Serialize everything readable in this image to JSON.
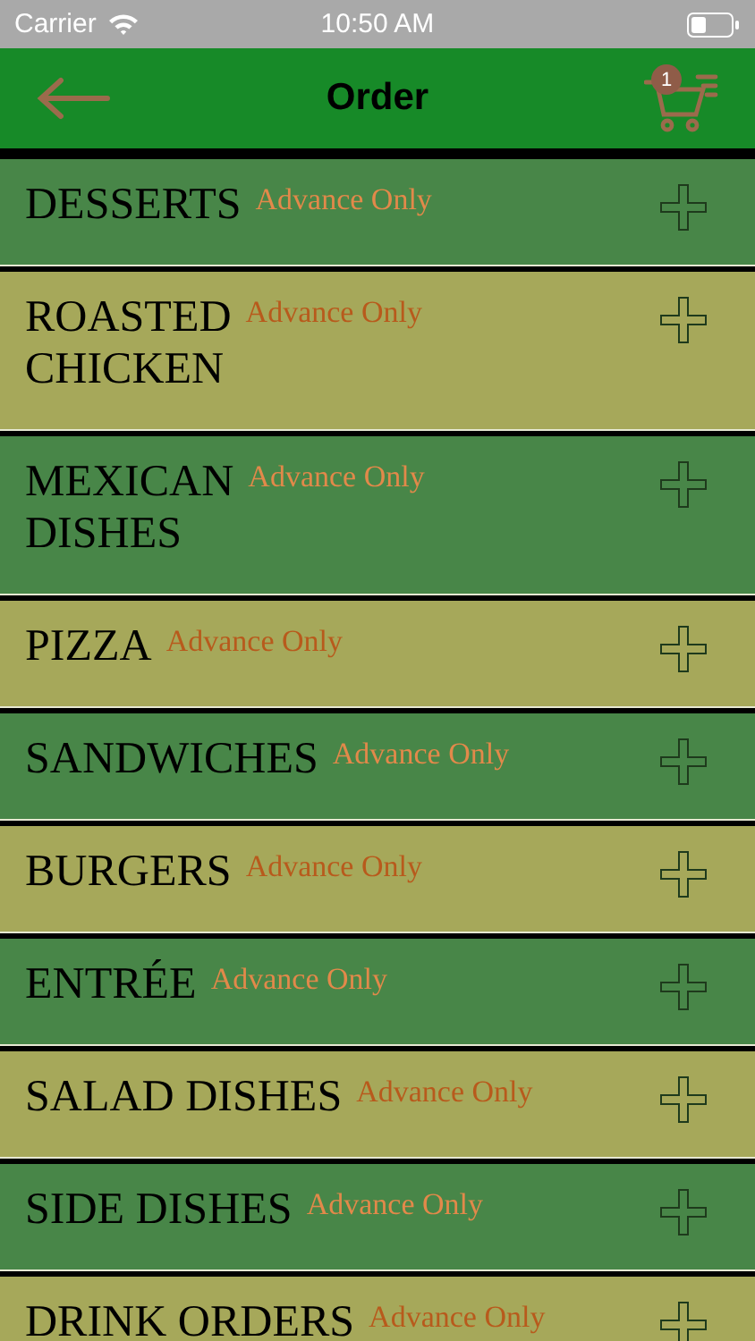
{
  "status_bar": {
    "carrier": "Carrier",
    "time": "10:50 AM"
  },
  "nav": {
    "title": "Order",
    "cart_count": "1"
  },
  "categories": [
    {
      "name": "DESSERTS",
      "note": "Advance Only"
    },
    {
      "name": "ROASTED\nCHICKEN",
      "note": "Advance Only"
    },
    {
      "name": "MEXICAN\nDISHES",
      "note": "Advance Only"
    },
    {
      "name": "PIZZA",
      "note": "Advance Only"
    },
    {
      "name": "SANDWICHES",
      "note": "Advance Only"
    },
    {
      "name": "BURGERS",
      "note": "Advance Only"
    },
    {
      "name": "ENTRÉE",
      "note": "Advance Only"
    },
    {
      "name": "SALAD DISHES",
      "note": "Advance Only"
    },
    {
      "name": "SIDE DISHES",
      "note": "Advance Only"
    },
    {
      "name": "DRINK ORDERS",
      "note": "Advance Only"
    }
  ]
}
